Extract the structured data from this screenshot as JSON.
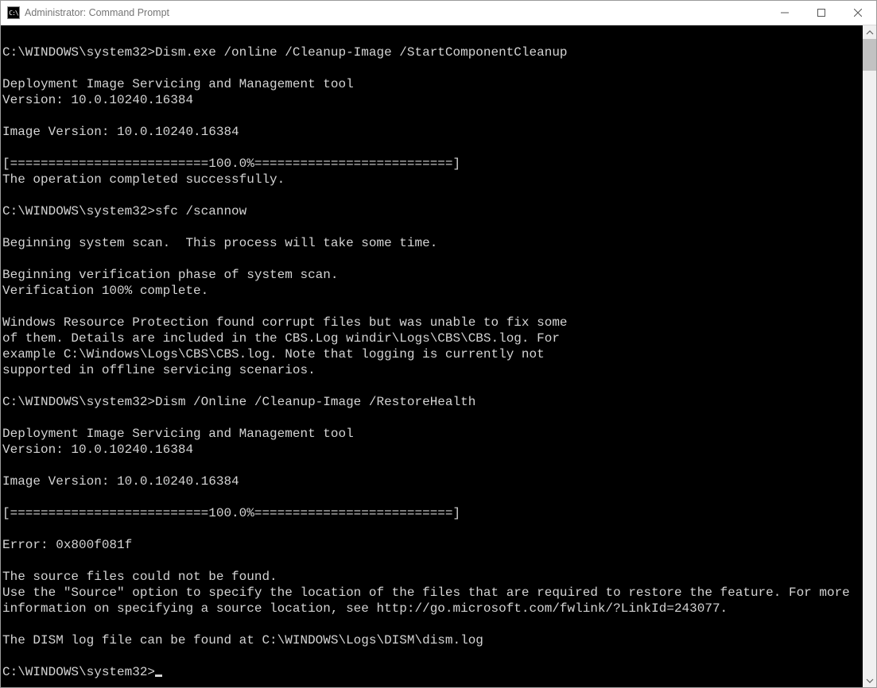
{
  "titlebar": {
    "icon_label": "C:\\",
    "title": "Administrator: Command Prompt"
  },
  "terminal": {
    "lines": [
      "",
      "C:\\WINDOWS\\system32>Dism.exe /online /Cleanup-Image /StartComponentCleanup",
      "",
      "Deployment Image Servicing and Management tool",
      "Version: 10.0.10240.16384",
      "",
      "Image Version: 10.0.10240.16384",
      "",
      "[==========================100.0%==========================]",
      "The operation completed successfully.",
      "",
      "C:\\WINDOWS\\system32>sfc /scannow",
      "",
      "Beginning system scan.  This process will take some time.",
      "",
      "Beginning verification phase of system scan.",
      "Verification 100% complete.",
      "",
      "Windows Resource Protection found corrupt files but was unable to fix some",
      "of them. Details are included in the CBS.Log windir\\Logs\\CBS\\CBS.log. For",
      "example C:\\Windows\\Logs\\CBS\\CBS.log. Note that logging is currently not",
      "supported in offline servicing scenarios.",
      "",
      "C:\\WINDOWS\\system32>Dism /Online /Cleanup-Image /RestoreHealth",
      "",
      "Deployment Image Servicing and Management tool",
      "Version: 10.0.10240.16384",
      "",
      "Image Version: 10.0.10240.16384",
      "",
      "[==========================100.0%==========================]",
      "",
      "Error: 0x800f081f",
      "",
      "The source files could not be found.",
      "Use the \"Source\" option to specify the location of the files that are required to restore the feature. For more information on specifying a source location, see http://go.microsoft.com/fwlink/?LinkId=243077.",
      "",
      "The DISM log file can be found at C:\\WINDOWS\\Logs\\DISM\\dism.log",
      ""
    ],
    "prompt": "C:\\WINDOWS\\system32>"
  }
}
